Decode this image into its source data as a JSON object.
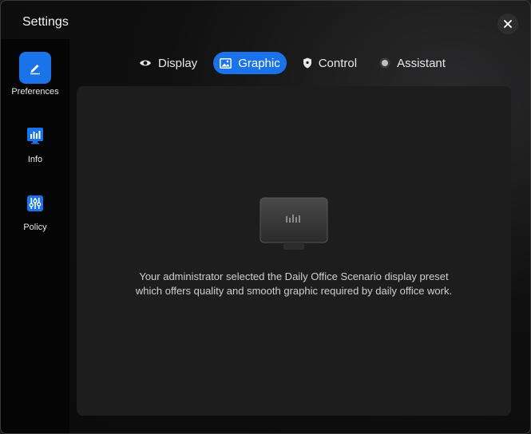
{
  "window": {
    "title": "Settings"
  },
  "sidebar": {
    "items": [
      {
        "label": "Preferences",
        "icon": "pencil-icon",
        "active": true
      },
      {
        "label": "Info",
        "icon": "bar-chart-icon",
        "active": false
      },
      {
        "label": "Policy",
        "icon": "sliders-icon",
        "active": false
      }
    ]
  },
  "tabs": [
    {
      "label": "Display",
      "icon": "eye-icon",
      "active": false
    },
    {
      "label": "Graphic",
      "icon": "image-icon",
      "active": true
    },
    {
      "label": "Control",
      "icon": "shield-icon",
      "active": false
    },
    {
      "label": "Assistant",
      "icon": "dot-icon",
      "active": false
    }
  ],
  "panel": {
    "message_line1": "Your administrator selected the Daily Office Scenario display preset",
    "message_line2": "which offers quality and smooth graphic required by daily office work."
  },
  "colors": {
    "accent": "#1a73e8",
    "panel": "#1d1d1d",
    "sidebar": "#050505"
  }
}
